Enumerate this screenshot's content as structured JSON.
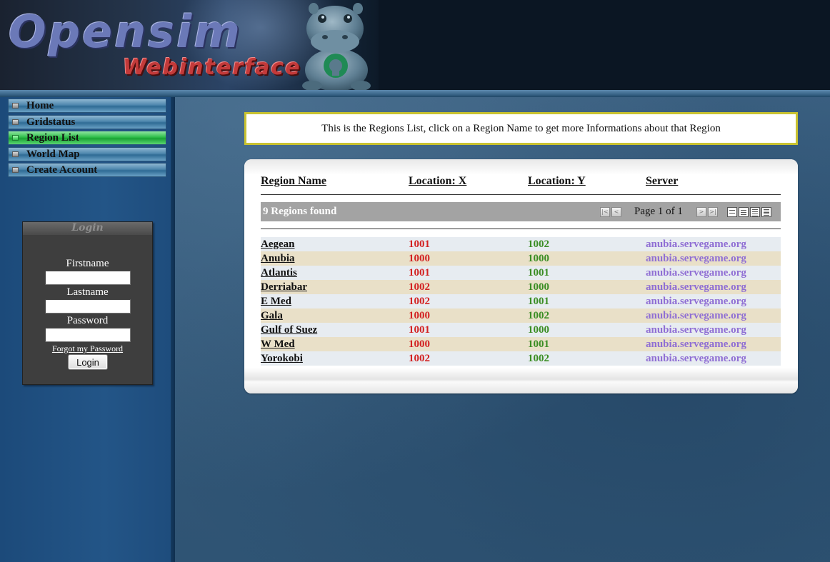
{
  "header": {
    "logo_title": "Opensim",
    "logo_subtitle": "Webinterface",
    "mascot_icon": "hippo-mascot-icon"
  },
  "nav": {
    "items": [
      {
        "label": "Home",
        "active": false
      },
      {
        "label": "Gridstatus",
        "active": false
      },
      {
        "label": "Region List",
        "active": true
      },
      {
        "label": "World Map",
        "active": false
      },
      {
        "label": "Create Account",
        "active": false
      }
    ]
  },
  "login": {
    "title": "Login",
    "firstname_label": "Firstname",
    "lastname_label": "Lastname",
    "password_label": "Password",
    "firstname_value": "",
    "lastname_value": "",
    "password_value": "",
    "forgot_link": "Forgot my Password",
    "button_label": "Login"
  },
  "info": {
    "message": "This is the Regions List, click on a Region Name to get more Informations about that Region"
  },
  "regions": {
    "columns": {
      "name": "Region Name",
      "x": "Location: X",
      "y": "Location: Y",
      "server": "Server"
    },
    "found_text": "9 Regions found",
    "page_text": "Page 1 of 1",
    "pager_icons": [
      "first-page-icon",
      "prev-page-icon",
      "next-page-icon",
      "last-page-icon"
    ],
    "view_icons": [
      "view-1-icon",
      "view-2-icon",
      "view-3-icon",
      "view-4-icon"
    ],
    "rows": [
      {
        "name": "Aegean",
        "x": "1001",
        "y": "1002",
        "server": "anubia.servegame.org"
      },
      {
        "name": "Anubia",
        "x": "1000",
        "y": "1000",
        "server": "anubia.servegame.org"
      },
      {
        "name": "Atlantis",
        "x": "1001",
        "y": "1001",
        "server": "anubia.servegame.org"
      },
      {
        "name": "Derriabar",
        "x": "1002",
        "y": "1000",
        "server": "anubia.servegame.org"
      },
      {
        "name": "E Med",
        "x": "1002",
        "y": "1001",
        "server": "anubia.servegame.org"
      },
      {
        "name": "Gala",
        "x": "1000",
        "y": "1002",
        "server": "anubia.servegame.org"
      },
      {
        "name": "Gulf of Suez",
        "x": "1001",
        "y": "1000",
        "server": "anubia.servegame.org"
      },
      {
        "name": "W Med",
        "x": "1000",
        "y": "1001",
        "server": "anubia.servegame.org"
      },
      {
        "name": "Yorokobi",
        "x": "1002",
        "y": "1002",
        "server": "anubia.servegame.org"
      }
    ]
  },
  "colors": {
    "x_value": "#d32222",
    "y_value": "#3a8d23",
    "server_value": "#8f6ed4",
    "info_border": "#c9c230",
    "nav_active": "#2fbe4a"
  }
}
